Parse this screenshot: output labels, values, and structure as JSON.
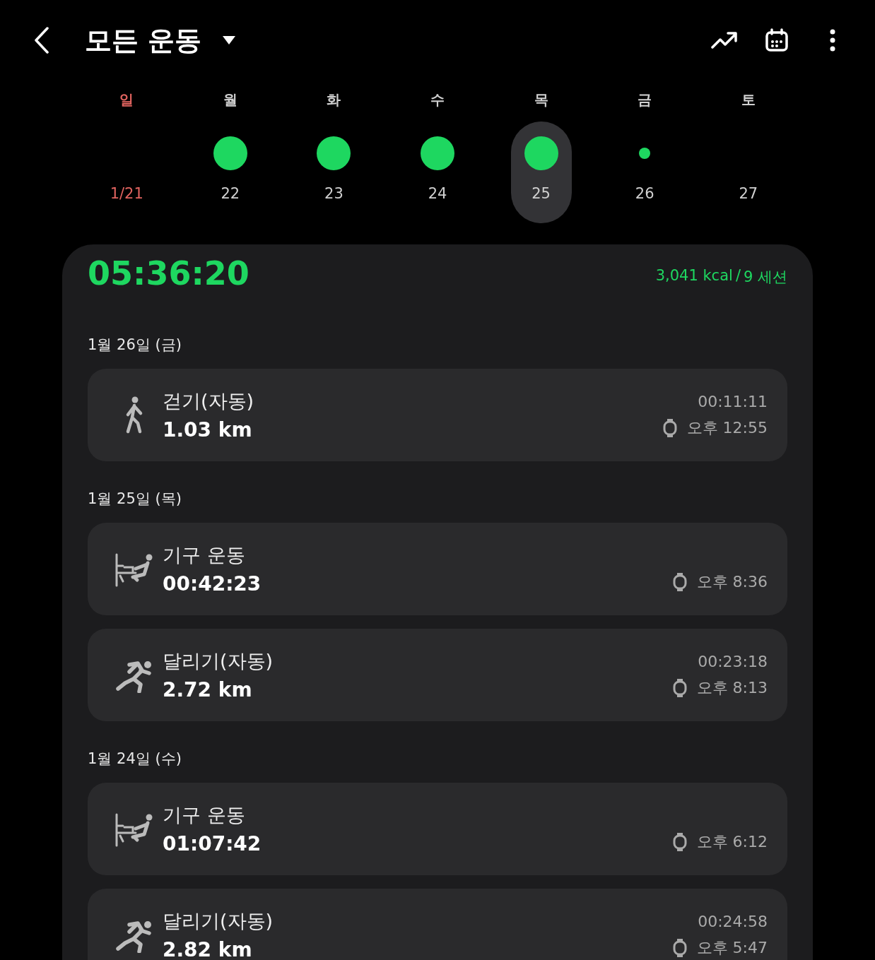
{
  "header": {
    "title": "모든 운동"
  },
  "week": [
    {
      "label": "일",
      "date": "1/21",
      "kind": "none",
      "selected": false,
      "color": "#e0635f"
    },
    {
      "label": "월",
      "date": "22",
      "kind": "large",
      "selected": false,
      "color": "#d0d0d0"
    },
    {
      "label": "화",
      "date": "23",
      "kind": "large",
      "selected": false,
      "color": "#d0d0d0"
    },
    {
      "label": "수",
      "date": "24",
      "kind": "large",
      "selected": false,
      "color": "#d0d0d0"
    },
    {
      "label": "목",
      "date": "25",
      "kind": "large",
      "selected": true,
      "color": "#d0d0d0"
    },
    {
      "label": "금",
      "date": "26",
      "kind": "small",
      "selected": false,
      "color": "#d0d0d0"
    },
    {
      "label": "토",
      "date": "27",
      "kind": "none",
      "selected": false,
      "color": "#d0d0d0"
    }
  ],
  "summary": {
    "total_time": "05:36:20",
    "calories": "3,041 kcal",
    "separator": "/",
    "sessions": "9 세션"
  },
  "sections": [
    {
      "date": "1월 26일 (금)",
      "entries": [
        {
          "kind": "walk",
          "name": "걷기(자동)",
          "value": "1.03 km",
          "duration": "00:11:11",
          "time": "오후 12:55"
        }
      ]
    },
    {
      "date": "1월 25일 (목)",
      "entries": [
        {
          "kind": "machine",
          "name": "기구 운동",
          "value": "00:42:23",
          "time": "오후 8:36"
        },
        {
          "kind": "run",
          "name": "달리기(자동)",
          "value": "2.72 km",
          "duration": "00:23:18",
          "time": "오후 8:13"
        }
      ]
    },
    {
      "date": "1월 24일 (수)",
      "entries": [
        {
          "kind": "machine",
          "name": "기구 운동",
          "value": "01:07:42",
          "time": "오후 6:12"
        },
        {
          "kind": "run",
          "name": "달리기(자동)",
          "value": "2.82 km",
          "duration": "00:24:58",
          "time": "오후 5:47"
        }
      ]
    }
  ]
}
